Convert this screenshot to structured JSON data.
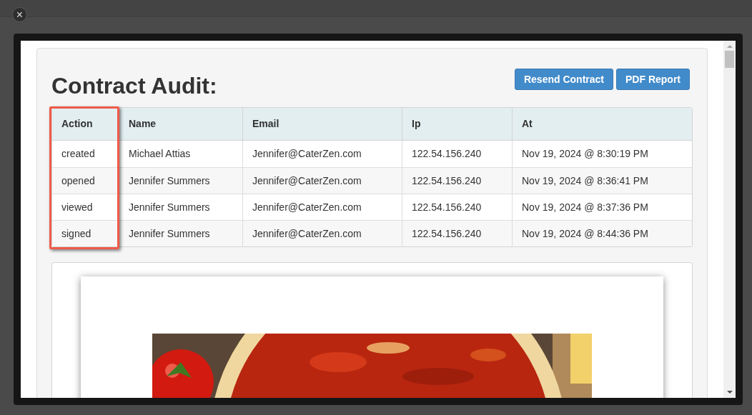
{
  "close_button": {
    "label": "×"
  },
  "modal": {
    "title": "Contract Audit:",
    "buttons": [
      "Resend Contract",
      "PDF Report"
    ],
    "table": {
      "columns": [
        "Action",
        "Name",
        "Email",
        "Ip",
        "At"
      ],
      "rows": [
        [
          "created",
          "Michael Attias",
          "Jennifer@CaterZen.com",
          "122.54.156.240",
          "Nov 19, 2024 @ 8:30:19 PM"
        ],
        [
          "opened",
          "Jennifer Summers",
          "Jennifer@CaterZen.com",
          "122.54.156.240",
          "Nov 19, 2024 @ 8:36:41 PM"
        ],
        [
          "viewed",
          "Jennifer Summers",
          "Jennifer@CaterZen.com",
          "122.54.156.240",
          "Nov 19, 2024 @ 8:37:36 PM"
        ],
        [
          "signed",
          "Jennifer Summers",
          "Jennifer@CaterZen.com",
          "122.54.156.240",
          "Nov 19, 2024 @ 8:44:36 PM"
        ]
      ]
    }
  }
}
